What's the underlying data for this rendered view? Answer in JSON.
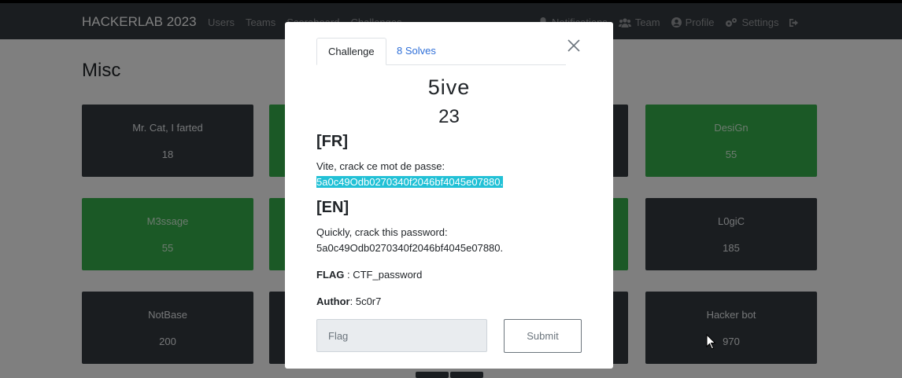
{
  "navbar": {
    "brand": "HACKERLAB 2023",
    "left_links": [
      "Users",
      "Teams",
      "Scoreboard",
      "Challenges"
    ],
    "right_links": [
      {
        "label": "Notifications",
        "icon": "bell-icon"
      },
      {
        "label": "Team",
        "icon": "users-icon"
      },
      {
        "label": "Profile",
        "icon": "user-circle-icon"
      },
      {
        "label": "Settings",
        "icon": "gears-icon"
      },
      {
        "label": "",
        "icon": "logout-icon"
      }
    ]
  },
  "page": {
    "title": "Misc"
  },
  "cards": [
    {
      "name": "Mr. Cat, I farted",
      "value": "18",
      "style": "dark"
    },
    {
      "name": "DesiGn",
      "value": "55",
      "style": "green"
    },
    {
      "name": "M3ssage",
      "value": "55",
      "style": "green"
    },
    {
      "name": "L0giC",
      "value": "185",
      "style": "dark"
    },
    {
      "name": "NotBase",
      "value": "200",
      "style": "dark"
    },
    {
      "name": "Hacker bot",
      "value": "970",
      "style": "dark"
    }
  ],
  "modal": {
    "tab_challenge": "Challenge",
    "tab_solves": "8 Solves",
    "challenge_name": "5ive",
    "challenge_value": "23",
    "fr_heading": "[FR]",
    "fr_text": "Vite, crack ce mot de passe:",
    "fr_hash": "5a0c49Odb0270340f2046bf4045e07880.",
    "en_heading": "[EN]",
    "en_text": "Quickly, crack this password:",
    "en_hash": "5a0c49Odb0270340f2046bf4045e07880.",
    "flag_label": "FLAG",
    "flag_value": " : CTF_password",
    "author_label": "Author",
    "author_value": ": 5c0r7",
    "flag_placeholder": "Flag",
    "submit_label": "Submit"
  },
  "colors": {
    "navbar": "#343a40",
    "card_dark": "#343a40",
    "card_green": "#37b24d",
    "link": "#2f6fd8",
    "highlight": "#22c1d6"
  }
}
